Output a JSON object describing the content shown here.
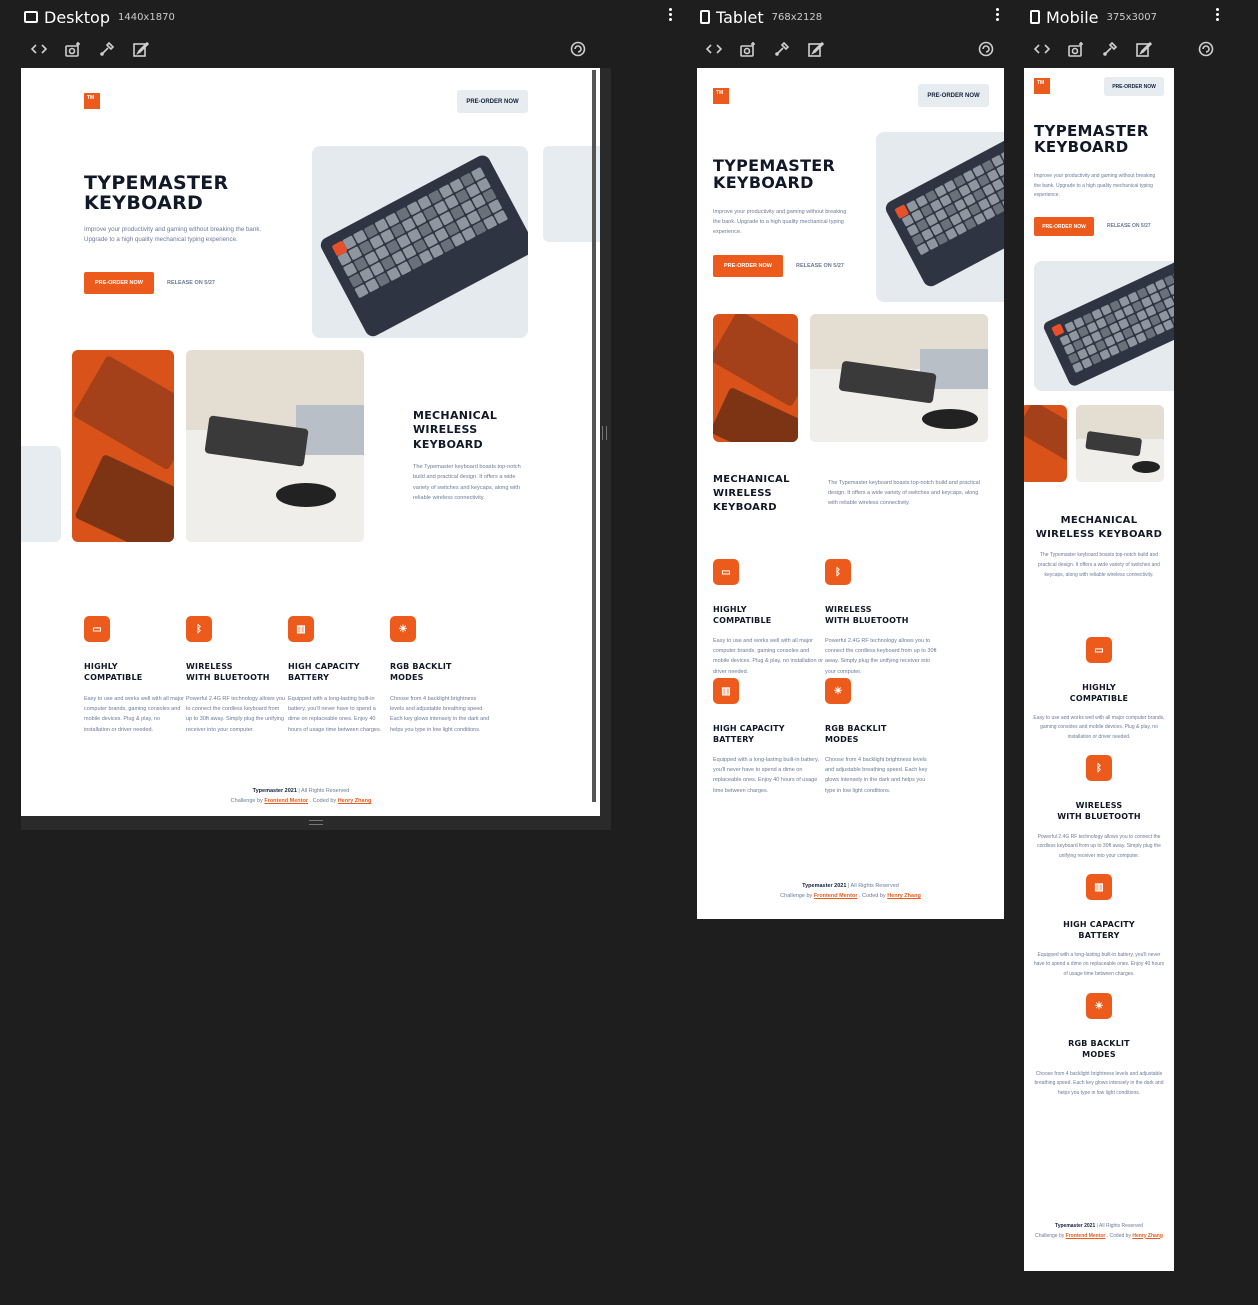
{
  "panes": {
    "desktop": {
      "name": "Desktop",
      "dims": "1440x1870"
    },
    "tablet": {
      "name": "Tablet",
      "dims": "768x2128"
    },
    "mobile": {
      "name": "Mobile",
      "dims": "375x3007"
    }
  },
  "toolbar_icons": [
    "code-icon",
    "camera-icon",
    "eyedropper-icon",
    "edit-icon",
    "rotate-icon"
  ],
  "site": {
    "logo": "TM",
    "preorder_top": "PRE-ORDER NOW",
    "hero_title_1": "TYPEMASTER",
    "hero_title_2": "KEYBOARD",
    "hero_text": "Improve your productivity and gaming without breaking the bank. Upgrade to a high quality mechanical typing experience.",
    "preorder_btn": "PRE-ORDER NOW",
    "release": "RELEASE ON 5/27",
    "section_title_1": "MECHANICAL",
    "section_title_2": "WIRELESS",
    "section_title_3": "KEYBOARD",
    "section_text": "The Typemaster keyboard boasts top-notch build and practical design. It offers a wide variety of switches and keycaps, along with reliable wireless connectivity.",
    "features": [
      {
        "icon": "monitor-icon",
        "title_1": "HIGHLY",
        "title_2": "COMPATIBLE",
        "text": "Easy to use and works well with all major computer brands, gaming consoles and mobile devices. Plug & play, no installation or driver needed."
      },
      {
        "icon": "bluetooth-icon",
        "title_1": "WIRELESS",
        "title_2": "WITH BLUETOOTH",
        "text": "Powerful 2.4G RF technology allows you to connect the cordless keyboard from up to 30ft away. Simply plug the unifying receiver into your computer."
      },
      {
        "icon": "battery-icon",
        "title_1": "HIGH CAPACITY",
        "title_2": "BATTERY",
        "text": "Equipped with a long-lasting built-in battery, you'll never have to spend a dime on replaceable ones. Enjoy 40 hours of usage time between charges."
      },
      {
        "icon": "sun-icon",
        "title_1": "RGB BACKLIT",
        "title_2": "MODES",
        "text": "Choose from 4 backlight brightness levels and adjustable breathing speed. Each key glows intensely in the dark and helps you type in low light conditions."
      }
    ],
    "footer_brand": "Typemaster 2021",
    "footer_rights": "| All Rights Reserved",
    "footer_challenge": "Challenge by",
    "footer_fm": "Frontend Mentor",
    "footer_coded": ". Coded by",
    "footer_author": "Henry Zhang"
  },
  "colors": {
    "accent": "#ec5b1b",
    "dark": "#111827",
    "muted": "#6b7a99",
    "chrome_bg": "#1e1e1e"
  }
}
